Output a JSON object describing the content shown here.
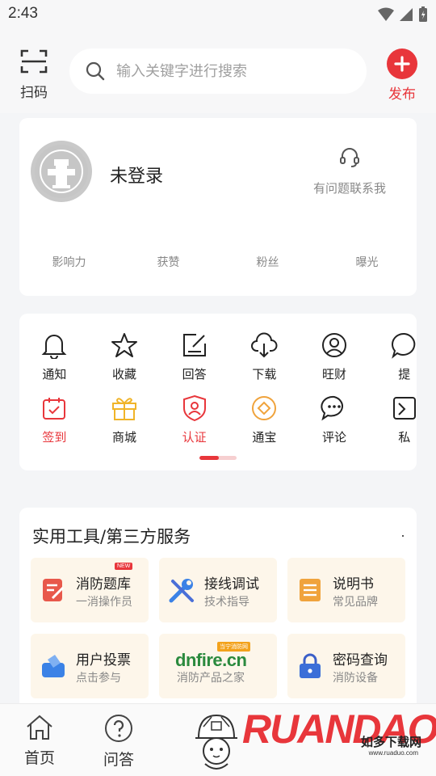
{
  "status_bar": {
    "time": "2:43"
  },
  "header": {
    "scan_label": "扫码",
    "search_placeholder": "输入关键字进行搜索",
    "publish_label": "发布"
  },
  "profile": {
    "name": "未登录",
    "contact_label": "有问题联系我",
    "stats": [
      "影响力",
      "获赞",
      "粉丝",
      "曝光"
    ]
  },
  "menu": {
    "row1": [
      {
        "label": "通知",
        "icon": "bell-icon"
      },
      {
        "label": "收藏",
        "icon": "star-icon"
      },
      {
        "label": "回答",
        "icon": "edit-icon"
      },
      {
        "label": "下载",
        "icon": "cloud-download-icon"
      },
      {
        "label": "旺财",
        "icon": "user-circle-icon"
      },
      {
        "label": "提",
        "icon": "chat-icon"
      }
    ],
    "row2": [
      {
        "label": "签到",
        "icon": "calendar-check-icon"
      },
      {
        "label": "商城",
        "icon": "gift-icon"
      },
      {
        "label": "认证",
        "icon": "shield-user-icon"
      },
      {
        "label": "通宝",
        "icon": "coin-icon"
      },
      {
        "label": "评论",
        "icon": "comment-icon"
      },
      {
        "label": "私",
        "icon": "message-icon"
      }
    ]
  },
  "tools": {
    "title": "实用工具/第三方服务",
    "items": [
      {
        "title": "消防题库",
        "subtitle": "一消操作员",
        "badge": "NEW",
        "icon": "question-bank-icon"
      },
      {
        "title": "接线调试",
        "subtitle": "技术指导",
        "icon": "wrench-icon"
      },
      {
        "title": "说明书",
        "subtitle": "常见品牌",
        "icon": "manual-icon"
      },
      {
        "title": "用户投票",
        "subtitle": "点击参与",
        "icon": "vote-icon"
      },
      {
        "brand": "dnfire.cn",
        "brand_badge": "当宁消防网",
        "subtitle": "消防产品之家",
        "icon": "dnfire-logo"
      },
      {
        "title": "密码查询",
        "subtitle": "消防设备",
        "icon": "lock-icon"
      }
    ]
  },
  "tabbar": {
    "tabs": [
      {
        "label": "首页",
        "icon": "home-icon"
      },
      {
        "label": "问答",
        "icon": "question-icon"
      }
    ]
  },
  "watermark": {
    "text": "RUANDAO",
    "cn": "如多下载网",
    "url": "www.ruaduo.com"
  },
  "colors": {
    "accent": "#e8363b",
    "tile_bg": "#fdf6ea",
    "blue": "#3b82e6",
    "orange": "#f0a33c"
  }
}
